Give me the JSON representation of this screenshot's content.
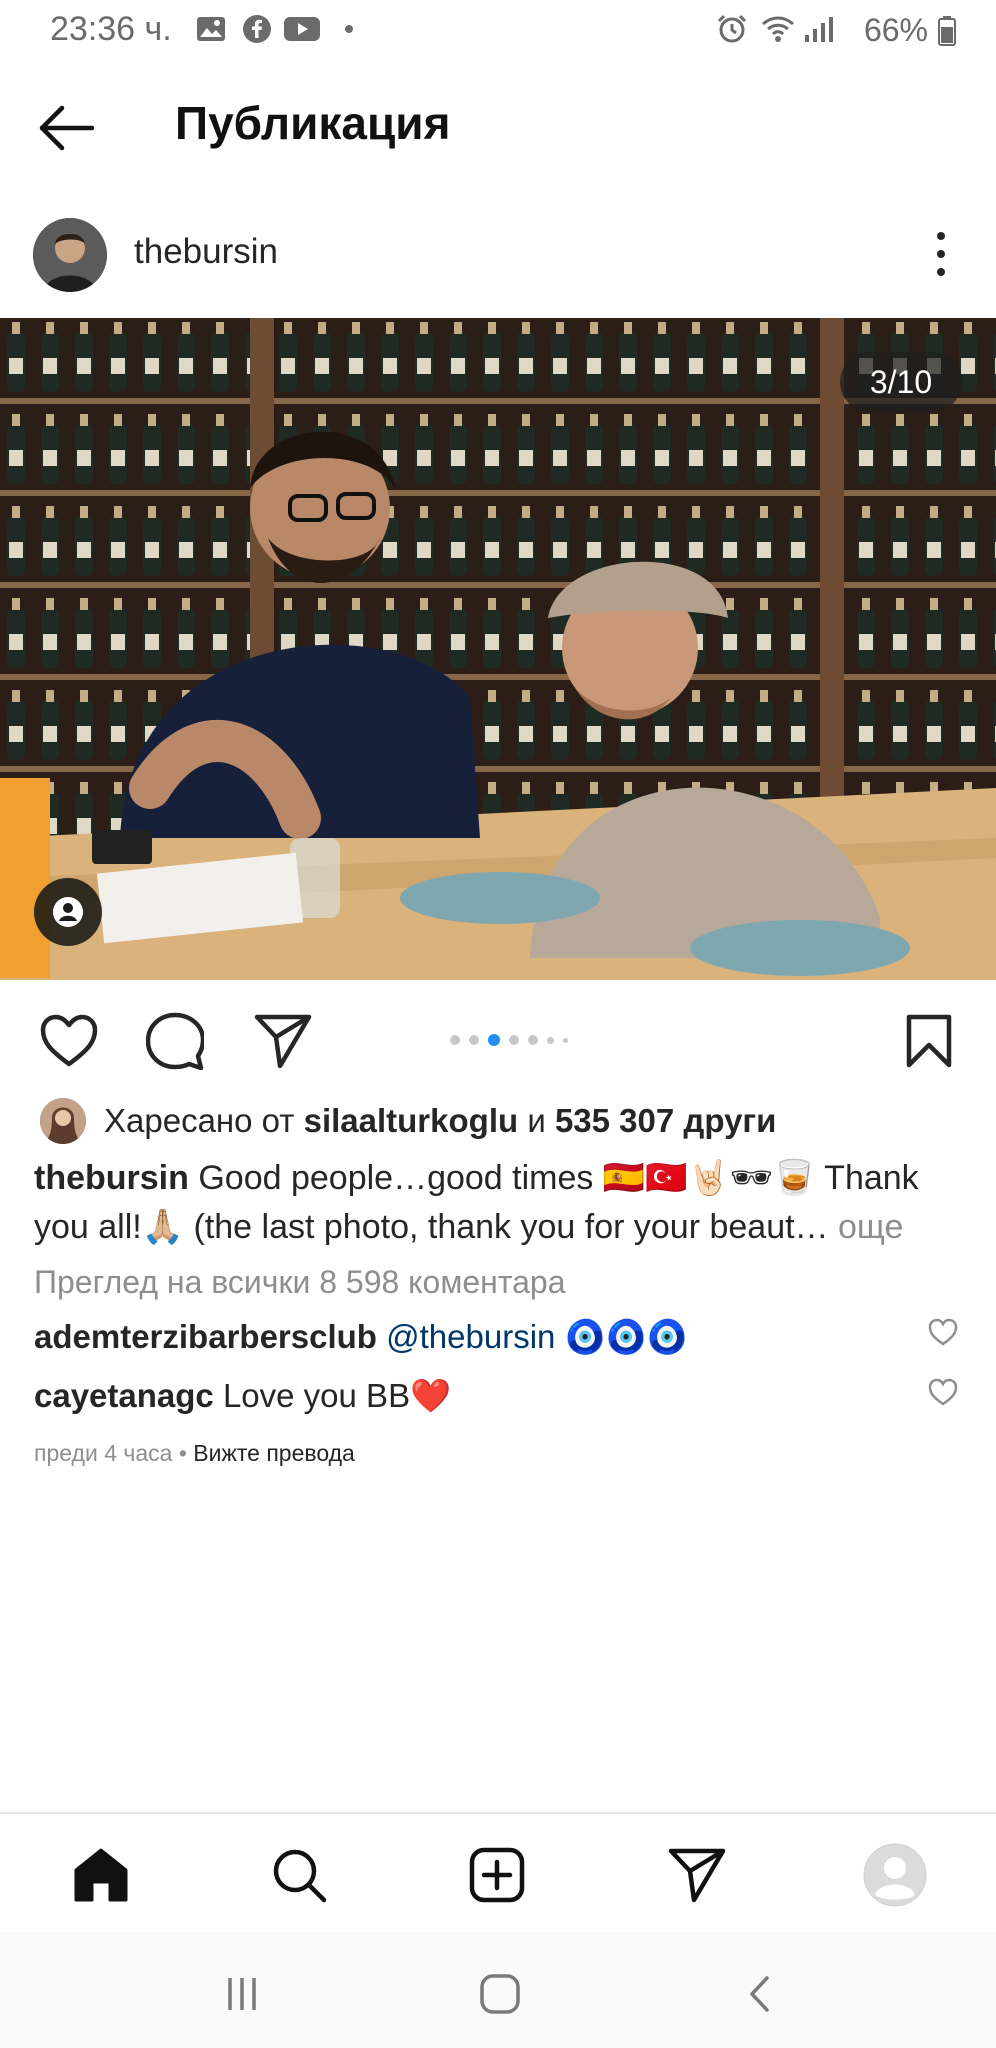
{
  "status_bar": {
    "time": "23:36 ч.",
    "battery": "66%"
  },
  "header": {
    "title": "Публикация"
  },
  "post": {
    "username": "thebursin",
    "slide_counter": "3/10",
    "likes": {
      "prefix": "Харесано от",
      "user": "silaalturkoglu",
      "conj": "и",
      "count": "535 307 други"
    },
    "caption": {
      "username": "thebursin",
      "text": "Good people…good times 🇪🇸🇹🇷🤘🏻🕶🥃 Thank you all!🙏🏼 (the last photo, thank you for your beaut…",
      "more": "още"
    },
    "view_comments": "Преглед на всички 8 598 коментара",
    "comments": [
      {
        "username": "ademterzibarbersclub",
        "mention": "@thebursin",
        "text": "🧿🧿🧿"
      },
      {
        "username": "cayetanagc",
        "mention": "",
        "text": "Love you BB❤️"
      }
    ],
    "time_ago": "преди 4 часа",
    "translate": "Вижте превода"
  },
  "colors": {
    "accent_dot": "#1f8ff1",
    "link": "#00376b",
    "muted": "#8e8e8e"
  }
}
